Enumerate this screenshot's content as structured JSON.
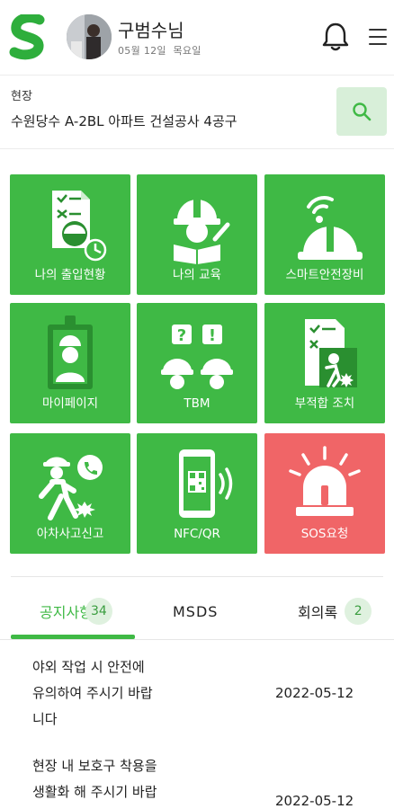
{
  "header": {
    "user_name": "구범수님",
    "date": "05월 12일",
    "weekday": "목요일"
  },
  "site": {
    "label": "현장",
    "name": "수원당수 A-2BL 아파트 건설공사 4공구"
  },
  "menu_tiles": [
    {
      "label": "나의 출입현황",
      "icon": "attendance-icon"
    },
    {
      "label": "나의 교육",
      "icon": "education-icon"
    },
    {
      "label": "스마트안전장비",
      "icon": "smart-helmet-icon"
    },
    {
      "label": "마이페이지",
      "icon": "id-card-icon"
    },
    {
      "label": "TBM",
      "icon": "tbm-icon"
    },
    {
      "label": "부적합 조치",
      "icon": "nonconformity-icon"
    },
    {
      "label": "아차사고신고",
      "icon": "near-miss-icon"
    },
    {
      "label": "NFC/QR",
      "icon": "nfc-qr-icon"
    },
    {
      "label": "SOS요청",
      "icon": "siren-icon"
    }
  ],
  "tabs": [
    {
      "label": "공지사항",
      "count": "34"
    },
    {
      "label": "MSDS"
    },
    {
      "label": "회의록",
      "count": "2"
    }
  ],
  "notices": [
    {
      "title": "야외 작업 시 안전에 유의하여 주시기 바랍니다",
      "date": "2022-05-12"
    },
    {
      "title": "현장 내 보호구 착용을 생활화 해 주시기 바랍니다",
      "date": "2022-05-12"
    }
  ],
  "colors": {
    "brand_green": "#3fb945",
    "sos_red": "#f06567",
    "badge_bg": "#dff1df"
  }
}
